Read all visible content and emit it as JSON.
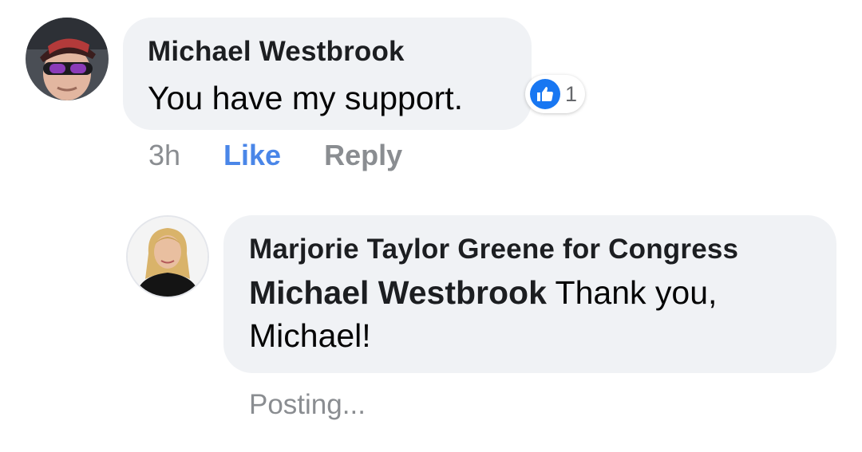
{
  "comment": {
    "author": "Michael Westbrook",
    "text": "You have my support.",
    "reaction": {
      "icon": "thumbs-up-icon",
      "count": "1",
      "color": "#1877f2"
    },
    "actions": {
      "time": "3h",
      "like_label": "Like",
      "reply_label": "Reply",
      "like_color": "#4a86e8"
    }
  },
  "reply": {
    "author": "Marjorie Taylor Greene for Congress",
    "mention": "Michael Westbrook",
    "text_line1": "Thank you,",
    "text_line2": "Michael!",
    "status": "Posting..."
  },
  "colors": {
    "bubble_background": "#f0f2f5",
    "secondary_text": "#8a8d91",
    "primary_text": "#050505"
  }
}
